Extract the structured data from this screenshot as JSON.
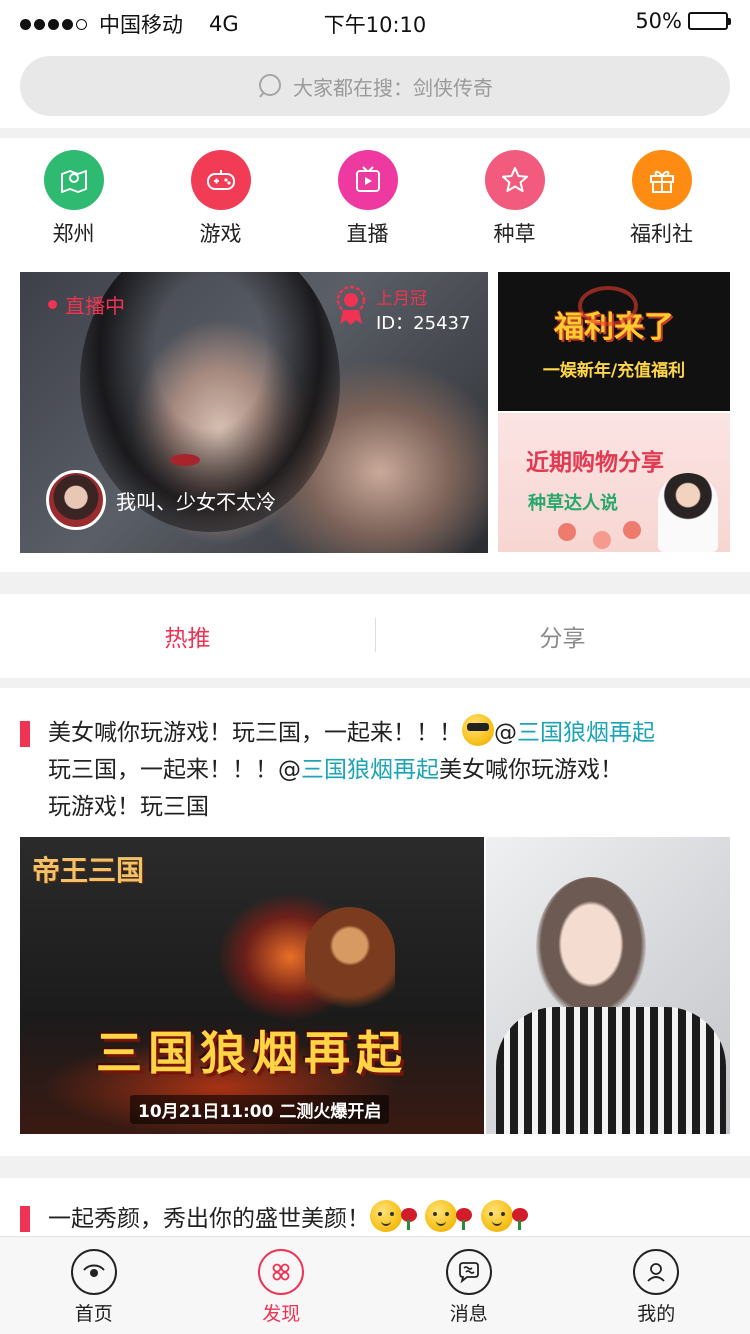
{
  "status_bar": {
    "carrier": "中国移动",
    "network": "4G",
    "time": "下午10:10",
    "battery": "50%",
    "battery_level": 0.5
  },
  "search": {
    "placeholder": "大家都在搜：剑侠传奇"
  },
  "categories": [
    {
      "label": "郑州",
      "icon": "map-icon",
      "color": "#2fba72"
    },
    {
      "label": "游戏",
      "icon": "gamepad-icon",
      "color": "#f23c55"
    },
    {
      "label": "直播",
      "icon": "tv-icon",
      "color": "#ee3aa0"
    },
    {
      "label": "种草",
      "icon": "star-icon",
      "color": "#f25b7d"
    },
    {
      "label": "福利社",
      "icon": "gift-icon",
      "color": "#ff8c12"
    }
  ],
  "live_banner": {
    "status": "直播中",
    "rank_label": "上月冠",
    "id_text": "ID：25437",
    "anchor_name": "我叫、少女不太冷"
  },
  "promo_welfare": {
    "title": "福利来了",
    "subtitle": "一娱新年/充值福利"
  },
  "promo_share": {
    "title": "近期购物分享",
    "subtitle": "种草达人说"
  },
  "feed_tabs": [
    "热推",
    "分享"
  ],
  "post1": {
    "t1": "美女喊你玩游戏！玩三国，一起来！！！",
    "at1": "@",
    "link1": "三国狼烟再起",
    "t2": "玩三国，一起来！！！",
    "at2": "@",
    "link2": "三国狼烟再起",
    "t3": "美女喊你玩游戏！",
    "t4": "玩游戏！玩三国",
    "game_logo": "帝王三国",
    "game_title": "三国狼烟再起",
    "game_sub": "10月21日11:00  二测火爆开启"
  },
  "post2": {
    "text": "一起秀颜，秀出你的盛世美颜！"
  },
  "tabbar": [
    {
      "label": "首页",
      "icon": "eye-icon"
    },
    {
      "label": "发现",
      "icon": "discover-icon"
    },
    {
      "label": "消息",
      "icon": "message-icon"
    },
    {
      "label": "我的",
      "icon": "profile-icon"
    }
  ],
  "colors": {
    "accent": "#ee3353",
    "link": "#1aa4b5"
  }
}
